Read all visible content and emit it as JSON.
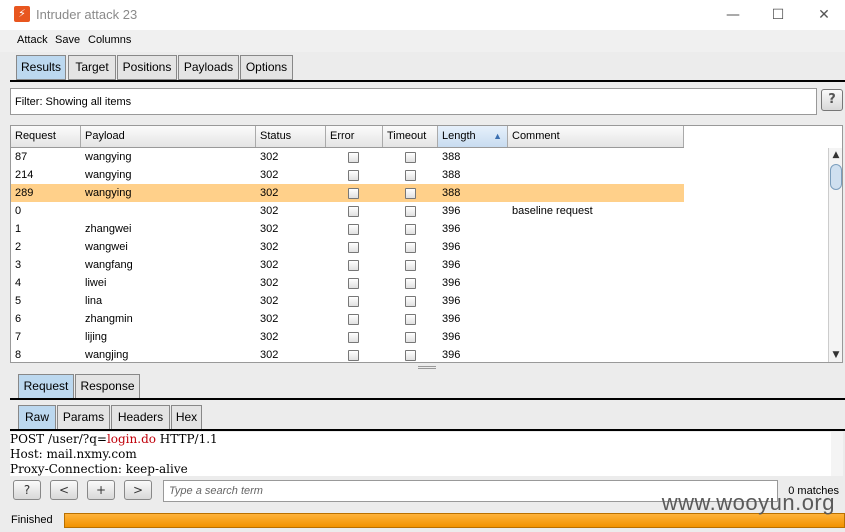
{
  "window": {
    "title": "Intruder attack 23",
    "app_icon_glyph": "⚡",
    "controls": {
      "minimize": "—",
      "maximize": "☐",
      "close": "✕"
    }
  },
  "menu": [
    "Attack",
    "Save",
    "Columns"
  ],
  "main_tabs": [
    "Results",
    "Target",
    "Positions",
    "Payloads",
    "Options"
  ],
  "active_main_tab": "Results",
  "filter": {
    "text": "Filter:  Showing all items",
    "help": "?"
  },
  "table": {
    "columns": [
      "Request",
      "Payload",
      "Status",
      "Error",
      "Timeout",
      "Length",
      "Comment"
    ],
    "sorted_column": "Length",
    "sort_direction_glyph": "▲",
    "rows": [
      {
        "request": "87",
        "payload": "wangying",
        "status": "302",
        "error": false,
        "timeout": false,
        "length": "388",
        "comment": ""
      },
      {
        "request": "214",
        "payload": "wangying",
        "status": "302",
        "error": false,
        "timeout": false,
        "length": "388",
        "comment": ""
      },
      {
        "request": "289",
        "payload": "wangying",
        "status": "302",
        "error": false,
        "timeout": false,
        "length": "388",
        "comment": "",
        "selected": true
      },
      {
        "request": "0",
        "payload": "",
        "status": "302",
        "error": false,
        "timeout": false,
        "length": "396",
        "comment": "baseline request"
      },
      {
        "request": "1",
        "payload": "zhangwei",
        "status": "302",
        "error": false,
        "timeout": false,
        "length": "396",
        "comment": ""
      },
      {
        "request": "2",
        "payload": "wangwei",
        "status": "302",
        "error": false,
        "timeout": false,
        "length": "396",
        "comment": ""
      },
      {
        "request": "3",
        "payload": "wangfang",
        "status": "302",
        "error": false,
        "timeout": false,
        "length": "396",
        "comment": ""
      },
      {
        "request": "4",
        "payload": "liwei",
        "status": "302",
        "error": false,
        "timeout": false,
        "length": "396",
        "comment": ""
      },
      {
        "request": "5",
        "payload": "lina",
        "status": "302",
        "error": false,
        "timeout": false,
        "length": "396",
        "comment": ""
      },
      {
        "request": "6",
        "payload": "zhangmin",
        "status": "302",
        "error": false,
        "timeout": false,
        "length": "396",
        "comment": ""
      },
      {
        "request": "7",
        "payload": "lijing",
        "status": "302",
        "error": false,
        "timeout": false,
        "length": "396",
        "comment": ""
      },
      {
        "request": "8",
        "payload": "wangjing",
        "status": "302",
        "error": false,
        "timeout": false,
        "length": "396",
        "comment": ""
      }
    ]
  },
  "message_tabs": [
    "Request",
    "Response"
  ],
  "active_message_tab": "Request",
  "view_tabs": [
    "Raw",
    "Params",
    "Headers",
    "Hex"
  ],
  "active_view_tab": "Raw",
  "raw_request": {
    "line1_prefix": "POST /user/?q=",
    "line1_highlight": "login.do",
    "line1_suffix": " HTTP/1.1",
    "line2": "Host: mail.nxmy.com",
    "line3": "Proxy-Connection: keep-alive"
  },
  "search": {
    "help": "?",
    "prev": "<",
    "add": "+",
    "next": ">",
    "placeholder": "Type a search term",
    "matches": "0 matches"
  },
  "status": {
    "text": "Finished",
    "progress": 1.0
  },
  "watermark": "www.wooyun.org",
  "colors": {
    "selected_row": "#ffd08a",
    "active_tab": "#bcd8ef",
    "progress": "#f29200",
    "highlight": "#c0000a"
  }
}
